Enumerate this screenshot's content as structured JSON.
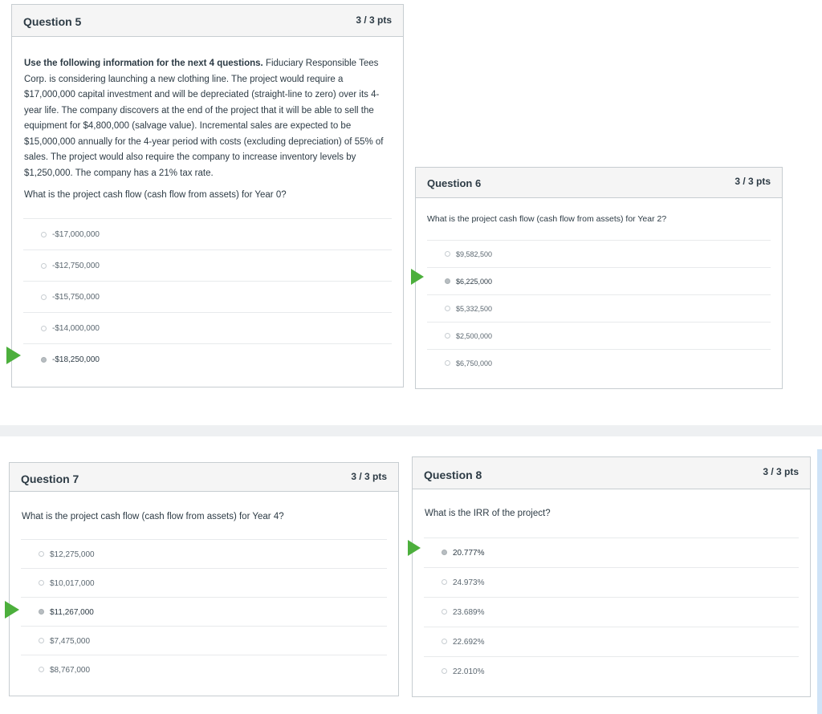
{
  "questions": [
    {
      "title": "Question 5",
      "points": "3 / 3 pts",
      "intro_bold": "Use the following information for the next 4 questions.",
      "intro_rest": " Fiduciary Responsible Tees Corp. is considering launching a new clothing line. The project would require a $17,000,000 capital investment and will be depreciated (straight-line to zero) over its 4-year life. The company discovers at the end of the project that it will be able to sell the equipment for $4,800,000 (salvage value). Incremental sales are expected to be $15,000,000 annually for the 4-year period with costs (excluding depreciation) of 55% of sales. The project would also require the company to increase inventory levels by $1,250,000. The company has a 21% tax rate.",
      "prompt": "What is the project cash flow (cash flow from assets) for Year 0?",
      "answers": [
        "-$17,000,000",
        "-$12,750,000",
        "-$15,750,000",
        "-$14,000,000",
        "-$18,250,000"
      ],
      "selected": 4
    },
    {
      "title": "Question 6",
      "points": "3 / 3 pts",
      "prompt": "What is the project cash flow (cash flow from assets) for Year 2?",
      "answers": [
        "$9,582,500",
        "$6,225,000",
        "$5,332,500",
        "$2,500,000",
        "$6,750,000"
      ],
      "selected": 1
    },
    {
      "title": "Question 7",
      "points": "3 / 3 pts",
      "prompt": "What is the project cash flow (cash flow from assets) for Year 4?",
      "answers": [
        "$12,275,000",
        "$10,017,000",
        "$11,267,000",
        "$7,475,000",
        "$8,767,000"
      ],
      "selected": 2
    },
    {
      "title": "Question 8",
      "points": "3 / 3 pts",
      "prompt": "What is the IRR of the project?",
      "answers": [
        "20.777%",
        "24.973%",
        "23.689%",
        "22.692%",
        "22.010%"
      ],
      "selected": 0
    }
  ],
  "colors": {
    "correct_flag": "#4caf3c",
    "border": "#c7cdd1",
    "header_bg": "#f5f5f5"
  }
}
